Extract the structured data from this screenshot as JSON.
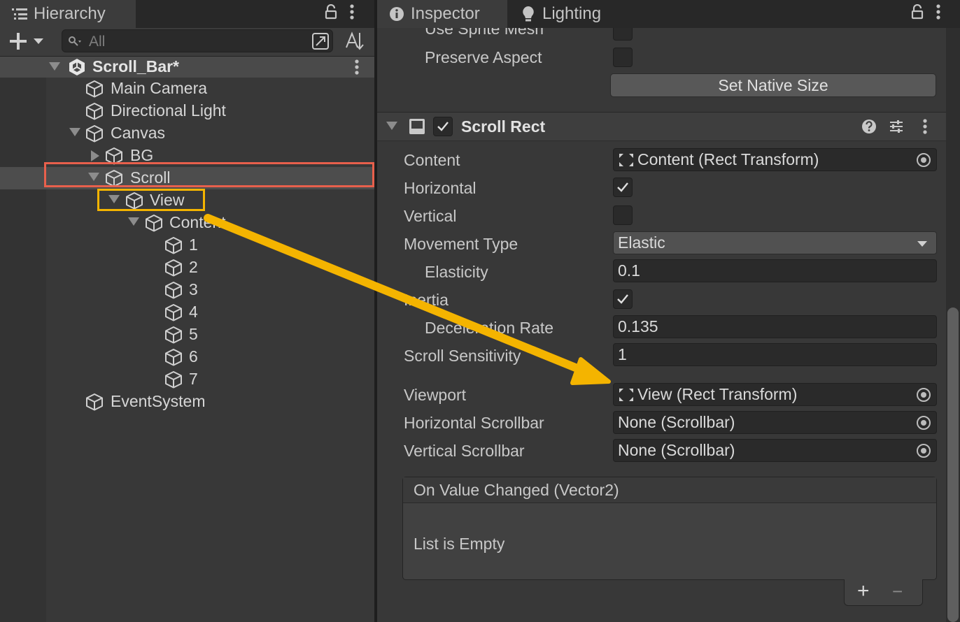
{
  "hierarchy": {
    "tab_title": "Hierarchy",
    "tab_icon": "hierarchy-list-icon",
    "search": {
      "placeholder": "All",
      "value": ""
    },
    "scene": {
      "name": "Scroll_Bar*"
    },
    "items": [
      {
        "label": "Main Camera"
      },
      {
        "label": "Directional Light"
      },
      {
        "label": "Canvas"
      },
      {
        "label": "BG"
      },
      {
        "label": "Scroll"
      },
      {
        "label": "View"
      },
      {
        "label": "Content"
      },
      {
        "label": "1"
      },
      {
        "label": "2"
      },
      {
        "label": "3"
      },
      {
        "label": "4"
      },
      {
        "label": "5"
      },
      {
        "label": "6"
      },
      {
        "label": "7"
      },
      {
        "label": "EventSystem"
      }
    ]
  },
  "inspector": {
    "tabs": [
      {
        "label": "Inspector",
        "icon": "info-icon"
      },
      {
        "label": "Lighting",
        "icon": "lightbulb-icon"
      }
    ],
    "top_props": {
      "use_sprite_mesh": "Use Sprite Mesh",
      "preserve_aspect": "Preserve Aspect",
      "set_native_size": "Set Native Size"
    },
    "component": {
      "title": "Scroll Rect",
      "enabled": true,
      "properties": {
        "content": {
          "label": "Content",
          "value": "Content (Rect Transform)"
        },
        "horizontal": {
          "label": "Horizontal",
          "checked": true
        },
        "vertical": {
          "label": "Vertical",
          "checked": false
        },
        "movement_type": {
          "label": "Movement Type",
          "value": "Elastic"
        },
        "elasticity": {
          "label": "Elasticity",
          "value": "0.1"
        },
        "inertia": {
          "label": "Inertia",
          "checked": true
        },
        "deceleration_rate": {
          "label": "Deceleration Rate",
          "value": "0.135"
        },
        "scroll_sensitivity": {
          "label": "Scroll Sensitivity",
          "value": "1"
        },
        "viewport": {
          "label": "Viewport",
          "value": "View (Rect Transform)"
        },
        "horizontal_scrollbar": {
          "label": "Horizontal Scrollbar",
          "value": "None (Scrollbar)"
        },
        "vertical_scrollbar": {
          "label": "Vertical Scrollbar",
          "value": "None (Scrollbar)"
        }
      },
      "event": {
        "title": "On Value Changed (Vector2)",
        "empty_text": "List is Empty",
        "add_label": "+",
        "remove_label": "−"
      }
    }
  },
  "colors": {
    "highlight_red": "#e8604c",
    "highlight_yellow": "#f4b400"
  }
}
